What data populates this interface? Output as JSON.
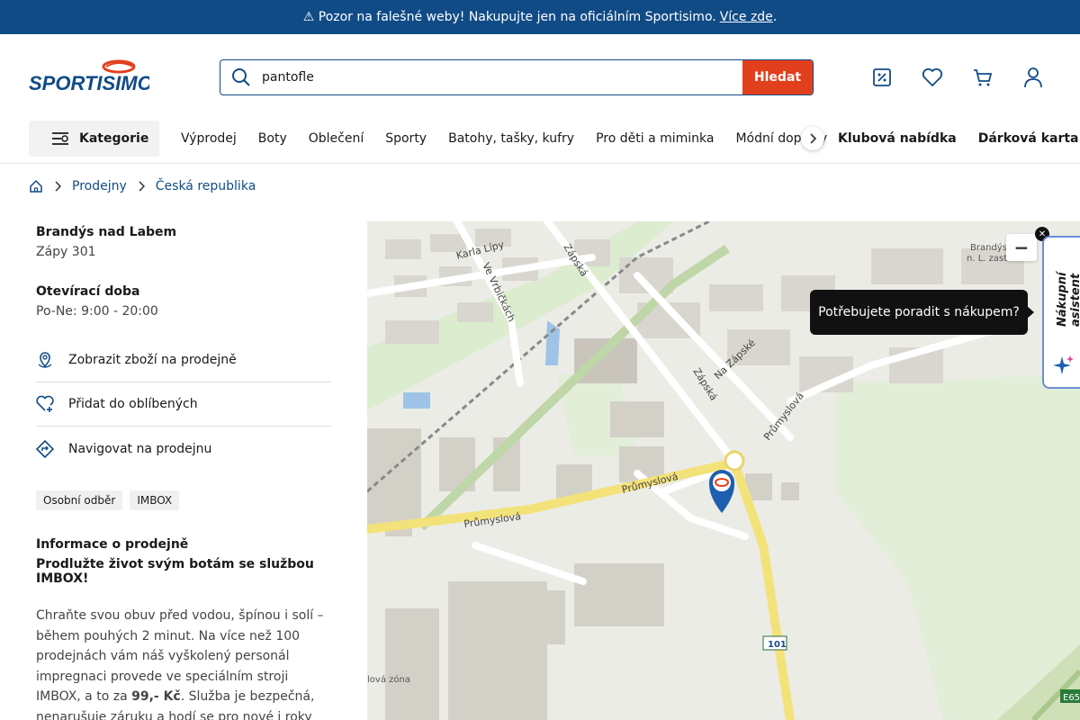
{
  "banner": {
    "text": "⚠ Pozor na falešné weby! Nakupujte jen na oficiálním Sportisimo.",
    "link": "Více zde",
    "end": "."
  },
  "header": {
    "logo": "SPORTISIMO",
    "search_value": "pantofle",
    "search_button": "Hledat",
    "icons": [
      "discount-icon",
      "heart-icon",
      "cart-icon",
      "user-icon"
    ]
  },
  "nav": {
    "category": "Kategorie",
    "links": [
      "Výprodej",
      "Boty",
      "Oblečení",
      "Sporty",
      "Batohy, tašky, kufry",
      "Pro děti a miminka",
      "Módní doplňky"
    ],
    "bold_links": [
      "Klubová nabídka",
      "Dárková karta"
    ]
  },
  "breadcrumb": [
    "Prodejny",
    "Česká republika"
  ],
  "store": {
    "city": "Brandýs nad Labem",
    "address": "Zápy 301",
    "hours_title": "Otevírací doba",
    "hours": "Po-Ne: 9:00 - 20:00",
    "actions": [
      "Zobrazit zboží na prodejně",
      "Přidat do oblíbených",
      "Navigovat na prodejnu"
    ],
    "tags": [
      "Osobní odběr",
      "IMBOX"
    ],
    "info_title": "Informace o prodejně",
    "info_subtitle": "Prodlužte život svým botám se službou IMBOX!",
    "info_text_1": "Chraňte svou obuv před vodou, špínou i solí – během pouhých 2 minut. Na více než 100 prodejnách vám náš vyškolený personál impregnaci provede ve speciálním stroji IMBOX, a to za ",
    "info_price": "99,- Kč",
    "info_text_2": ". Služba je bezpečná, nenarušuje záruku a hodí se pro nové i roky nošené boty."
  },
  "map": {
    "labels": {
      "karla_lipy": "Karla Lípy",
      "ve_vrbickach": "Ve Vrbičkách",
      "zapska_1": "Zápská",
      "zapska_2": "Zápská",
      "na_zapske": "Na Zápské",
      "prumyslova_1": "Průmyslová",
      "prumyslova_2": "Průmyslová",
      "prumyslova_3": "Průmyslová",
      "road_101": "101",
      "zone": "lová zóna",
      "brandys_stop_1": "Brandýs",
      "brandys_stop_2": "n. L. zast.",
      "e65": "E65"
    },
    "zoom_out": "−"
  },
  "assistant": {
    "tooltip": "Potřebujete poradit s nákupem?",
    "label": "Nákupní asistent"
  }
}
